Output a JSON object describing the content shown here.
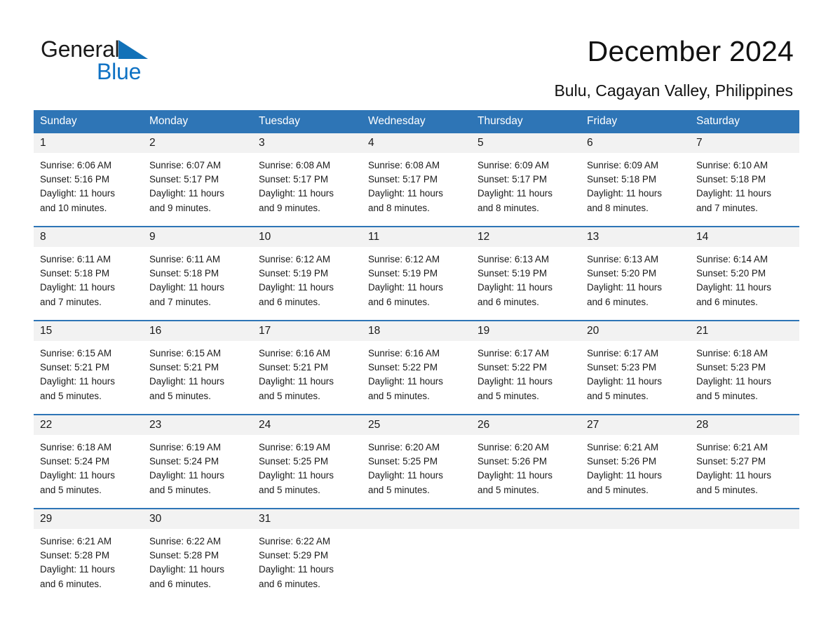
{
  "brand": {
    "word1": "General",
    "word2": "Blue",
    "triangle_color": "#1271b8",
    "accent_color": "#2e75b6"
  },
  "header": {
    "title": "December 2024",
    "location": "Bulu, Cagayan Valley, Philippines"
  },
  "calendar": {
    "weekday_headers": [
      "Sunday",
      "Monday",
      "Tuesday",
      "Wednesday",
      "Thursday",
      "Friday",
      "Saturday"
    ],
    "labels": {
      "sunrise": "Sunrise:",
      "sunset": "Sunset:",
      "daylight": "Daylight:"
    },
    "weeks": [
      [
        {
          "day": "1",
          "sunrise": "Sunrise: 6:06 AM",
          "sunset": "Sunset: 5:16 PM",
          "daylight_line1": "Daylight: 11 hours",
          "daylight_line2": "and 10 minutes."
        },
        {
          "day": "2",
          "sunrise": "Sunrise: 6:07 AM",
          "sunset": "Sunset: 5:17 PM",
          "daylight_line1": "Daylight: 11 hours",
          "daylight_line2": "and 9 minutes."
        },
        {
          "day": "3",
          "sunrise": "Sunrise: 6:08 AM",
          "sunset": "Sunset: 5:17 PM",
          "daylight_line1": "Daylight: 11 hours",
          "daylight_line2": "and 9 minutes."
        },
        {
          "day": "4",
          "sunrise": "Sunrise: 6:08 AM",
          "sunset": "Sunset: 5:17 PM",
          "daylight_line1": "Daylight: 11 hours",
          "daylight_line2": "and 8 minutes."
        },
        {
          "day": "5",
          "sunrise": "Sunrise: 6:09 AM",
          "sunset": "Sunset: 5:17 PM",
          "daylight_line1": "Daylight: 11 hours",
          "daylight_line2": "and 8 minutes."
        },
        {
          "day": "6",
          "sunrise": "Sunrise: 6:09 AM",
          "sunset": "Sunset: 5:18 PM",
          "daylight_line1": "Daylight: 11 hours",
          "daylight_line2": "and 8 minutes."
        },
        {
          "day": "7",
          "sunrise": "Sunrise: 6:10 AM",
          "sunset": "Sunset: 5:18 PM",
          "daylight_line1": "Daylight: 11 hours",
          "daylight_line2": "and 7 minutes."
        }
      ],
      [
        {
          "day": "8",
          "sunrise": "Sunrise: 6:11 AM",
          "sunset": "Sunset: 5:18 PM",
          "daylight_line1": "Daylight: 11 hours",
          "daylight_line2": "and 7 minutes."
        },
        {
          "day": "9",
          "sunrise": "Sunrise: 6:11 AM",
          "sunset": "Sunset: 5:18 PM",
          "daylight_line1": "Daylight: 11 hours",
          "daylight_line2": "and 7 minutes."
        },
        {
          "day": "10",
          "sunrise": "Sunrise: 6:12 AM",
          "sunset": "Sunset: 5:19 PM",
          "daylight_line1": "Daylight: 11 hours",
          "daylight_line2": "and 6 minutes."
        },
        {
          "day": "11",
          "sunrise": "Sunrise: 6:12 AM",
          "sunset": "Sunset: 5:19 PM",
          "daylight_line1": "Daylight: 11 hours",
          "daylight_line2": "and 6 minutes."
        },
        {
          "day": "12",
          "sunrise": "Sunrise: 6:13 AM",
          "sunset": "Sunset: 5:19 PM",
          "daylight_line1": "Daylight: 11 hours",
          "daylight_line2": "and 6 minutes."
        },
        {
          "day": "13",
          "sunrise": "Sunrise: 6:13 AM",
          "sunset": "Sunset: 5:20 PM",
          "daylight_line1": "Daylight: 11 hours",
          "daylight_line2": "and 6 minutes."
        },
        {
          "day": "14",
          "sunrise": "Sunrise: 6:14 AM",
          "sunset": "Sunset: 5:20 PM",
          "daylight_line1": "Daylight: 11 hours",
          "daylight_line2": "and 6 minutes."
        }
      ],
      [
        {
          "day": "15",
          "sunrise": "Sunrise: 6:15 AM",
          "sunset": "Sunset: 5:21 PM",
          "daylight_line1": "Daylight: 11 hours",
          "daylight_line2": "and 5 minutes."
        },
        {
          "day": "16",
          "sunrise": "Sunrise: 6:15 AM",
          "sunset": "Sunset: 5:21 PM",
          "daylight_line1": "Daylight: 11 hours",
          "daylight_line2": "and 5 minutes."
        },
        {
          "day": "17",
          "sunrise": "Sunrise: 6:16 AM",
          "sunset": "Sunset: 5:21 PM",
          "daylight_line1": "Daylight: 11 hours",
          "daylight_line2": "and 5 minutes."
        },
        {
          "day": "18",
          "sunrise": "Sunrise: 6:16 AM",
          "sunset": "Sunset: 5:22 PM",
          "daylight_line1": "Daylight: 11 hours",
          "daylight_line2": "and 5 minutes."
        },
        {
          "day": "19",
          "sunrise": "Sunrise: 6:17 AM",
          "sunset": "Sunset: 5:22 PM",
          "daylight_line1": "Daylight: 11 hours",
          "daylight_line2": "and 5 minutes."
        },
        {
          "day": "20",
          "sunrise": "Sunrise: 6:17 AM",
          "sunset": "Sunset: 5:23 PM",
          "daylight_line1": "Daylight: 11 hours",
          "daylight_line2": "and 5 minutes."
        },
        {
          "day": "21",
          "sunrise": "Sunrise: 6:18 AM",
          "sunset": "Sunset: 5:23 PM",
          "daylight_line1": "Daylight: 11 hours",
          "daylight_line2": "and 5 minutes."
        }
      ],
      [
        {
          "day": "22",
          "sunrise": "Sunrise: 6:18 AM",
          "sunset": "Sunset: 5:24 PM",
          "daylight_line1": "Daylight: 11 hours",
          "daylight_line2": "and 5 minutes."
        },
        {
          "day": "23",
          "sunrise": "Sunrise: 6:19 AM",
          "sunset": "Sunset: 5:24 PM",
          "daylight_line1": "Daylight: 11 hours",
          "daylight_line2": "and 5 minutes."
        },
        {
          "day": "24",
          "sunrise": "Sunrise: 6:19 AM",
          "sunset": "Sunset: 5:25 PM",
          "daylight_line1": "Daylight: 11 hours",
          "daylight_line2": "and 5 minutes."
        },
        {
          "day": "25",
          "sunrise": "Sunrise: 6:20 AM",
          "sunset": "Sunset: 5:25 PM",
          "daylight_line1": "Daylight: 11 hours",
          "daylight_line2": "and 5 minutes."
        },
        {
          "day": "26",
          "sunrise": "Sunrise: 6:20 AM",
          "sunset": "Sunset: 5:26 PM",
          "daylight_line1": "Daylight: 11 hours",
          "daylight_line2": "and 5 minutes."
        },
        {
          "day": "27",
          "sunrise": "Sunrise: 6:21 AM",
          "sunset": "Sunset: 5:26 PM",
          "daylight_line1": "Daylight: 11 hours",
          "daylight_line2": "and 5 minutes."
        },
        {
          "day": "28",
          "sunrise": "Sunrise: 6:21 AM",
          "sunset": "Sunset: 5:27 PM",
          "daylight_line1": "Daylight: 11 hours",
          "daylight_line2": "and 5 minutes."
        }
      ],
      [
        {
          "day": "29",
          "sunrise": "Sunrise: 6:21 AM",
          "sunset": "Sunset: 5:28 PM",
          "daylight_line1": "Daylight: 11 hours",
          "daylight_line2": "and 6 minutes."
        },
        {
          "day": "30",
          "sunrise": "Sunrise: 6:22 AM",
          "sunset": "Sunset: 5:28 PM",
          "daylight_line1": "Daylight: 11 hours",
          "daylight_line2": "and 6 minutes."
        },
        {
          "day": "31",
          "sunrise": "Sunrise: 6:22 AM",
          "sunset": "Sunset: 5:29 PM",
          "daylight_line1": "Daylight: 11 hours",
          "daylight_line2": "and 6 minutes."
        },
        {
          "day": "",
          "sunrise": "",
          "sunset": "",
          "daylight_line1": "",
          "daylight_line2": ""
        },
        {
          "day": "",
          "sunrise": "",
          "sunset": "",
          "daylight_line1": "",
          "daylight_line2": ""
        },
        {
          "day": "",
          "sunrise": "",
          "sunset": "",
          "daylight_line1": "",
          "daylight_line2": ""
        },
        {
          "day": "",
          "sunrise": "",
          "sunset": "",
          "daylight_line1": "",
          "daylight_line2": ""
        }
      ]
    ]
  }
}
